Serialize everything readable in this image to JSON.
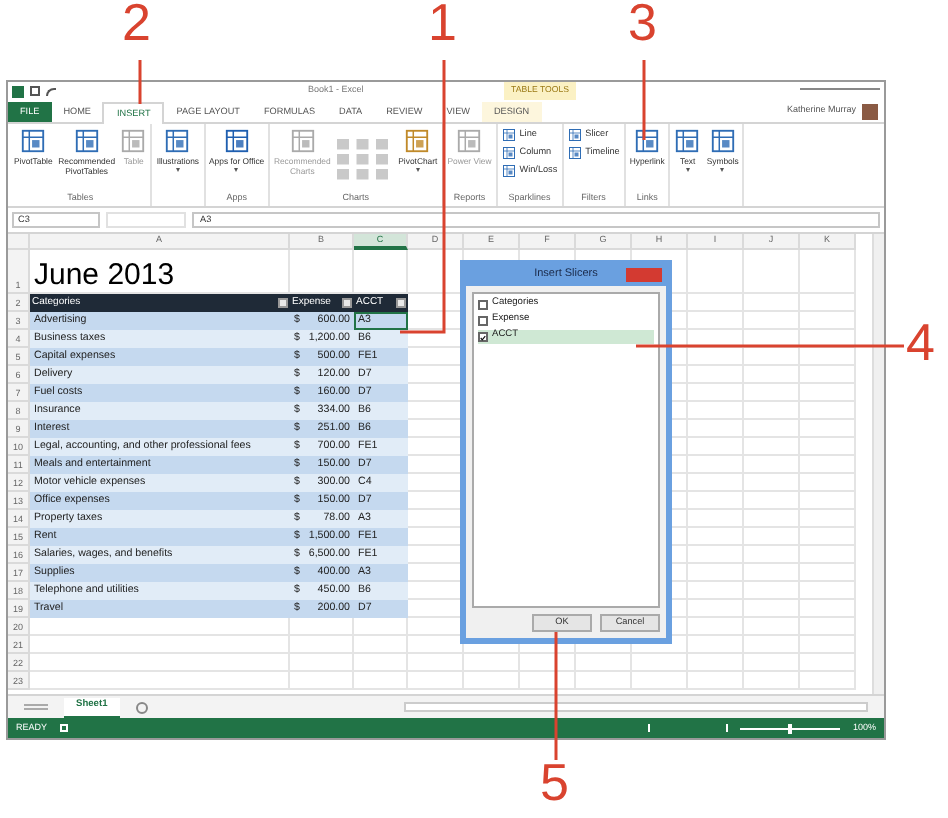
{
  "callouts": [
    {
      "label": "2"
    },
    {
      "label": "1"
    },
    {
      "label": "3"
    },
    {
      "label": "4"
    },
    {
      "label": "5"
    }
  ],
  "window": {
    "title": "Book1 - Excel",
    "contextual_group": "TABLE TOOLS",
    "user": "Katherine Murray"
  },
  "ribbon_tabs": [
    {
      "label": "FILE",
      "kind": "file",
      "selected": false
    },
    {
      "label": "HOME",
      "kind": "tab",
      "selected": false
    },
    {
      "label": "INSERT",
      "kind": "tab",
      "selected": true
    },
    {
      "label": "PAGE LAYOUT",
      "kind": "tab",
      "selected": false
    },
    {
      "label": "FORMULAS",
      "kind": "tab",
      "selected": false
    },
    {
      "label": "DATA",
      "kind": "tab",
      "selected": false
    },
    {
      "label": "REVIEW",
      "kind": "tab",
      "selected": false
    },
    {
      "label": "VIEW",
      "kind": "tab",
      "selected": false
    },
    {
      "label": "DESIGN",
      "kind": "contextual",
      "selected": false
    }
  ],
  "ribbon_groups": [
    {
      "label": "Tables",
      "commands": [
        {
          "label": "PivotTable",
          "kind": "large",
          "disabled": false,
          "dropdown": false
        },
        {
          "label": "Recommended PivotTables",
          "kind": "large",
          "disabled": false,
          "dropdown": false
        },
        {
          "label": "Table",
          "kind": "large",
          "disabled": true,
          "dropdown": false
        }
      ]
    },
    {
      "commands": [
        {
          "label": "Illustrations",
          "kind": "large",
          "disabled": false,
          "dropdown": true
        }
      ]
    },
    {
      "label": "Apps",
      "commands": [
        {
          "label": "Apps for Office",
          "kind": "large",
          "disabled": false,
          "dropdown": true
        }
      ]
    },
    {
      "label": "Charts",
      "commands": [
        {
          "label": "Recommended Charts",
          "kind": "large",
          "disabled": true,
          "dropdown": false
        },
        {
          "kind": "chart-grid",
          "disabled": true
        },
        {
          "label": "PivotChart",
          "kind": "large",
          "disabled": false,
          "dropdown": true
        }
      ]
    },
    {
      "label": "Reports",
      "commands": [
        {
          "label": "Power View",
          "kind": "large",
          "disabled": true,
          "dropdown": false
        }
      ]
    },
    {
      "label": "Sparklines",
      "commands": [
        {
          "label": "Line",
          "kind": "small",
          "disabled": false
        },
        {
          "label": "Column",
          "kind": "small",
          "disabled": false
        },
        {
          "label": "Win/Loss",
          "kind": "small",
          "disabled": false
        }
      ]
    },
    {
      "label": "Filters",
      "commands": [
        {
          "label": "Slicer",
          "kind": "small",
          "disabled": false
        },
        {
          "label": "Timeline",
          "kind": "small",
          "disabled": false
        }
      ]
    },
    {
      "label": "Links",
      "commands": [
        {
          "label": "Hyperlink",
          "kind": "large",
          "disabled": false,
          "dropdown": false
        }
      ]
    },
    {
      "commands": [
        {
          "label": "Text",
          "kind": "large",
          "disabled": false,
          "dropdown": true
        },
        {
          "label": "Symbols",
          "kind": "large",
          "disabled": false,
          "dropdown": true
        }
      ]
    }
  ],
  "formula_bar": {
    "name_box": "C3",
    "formula": "A3"
  },
  "columns": [
    {
      "label": "A",
      "selected": false
    },
    {
      "label": "B",
      "selected": false
    },
    {
      "label": "C",
      "selected": true
    },
    {
      "label": "D",
      "selected": false
    },
    {
      "label": "E",
      "selected": false
    },
    {
      "label": "F",
      "selected": false
    },
    {
      "label": "G",
      "selected": false
    },
    {
      "label": "H",
      "selected": false
    },
    {
      "label": "I",
      "selected": false
    },
    {
      "label": "J",
      "selected": false
    },
    {
      "label": "K",
      "selected": false
    }
  ],
  "sheet": {
    "title_row": "1",
    "title": "June 2013",
    "header_row": "2",
    "headers": [
      "Categories",
      "Expense",
      "ACCT"
    ],
    "rows": [
      {
        "row": "3",
        "category": "Advertising",
        "currency": "$",
        "amount": "600.00",
        "acct": "A3",
        "selected": true
      },
      {
        "row": "4",
        "category": "Business taxes",
        "currency": "$",
        "amount": "1,200.00",
        "acct": "B6",
        "selected": false
      },
      {
        "row": "5",
        "category": "Capital expenses",
        "currency": "$",
        "amount": "500.00",
        "acct": "FE1",
        "selected": false
      },
      {
        "row": "6",
        "category": "Delivery",
        "currency": "$",
        "amount": "120.00",
        "acct": "D7",
        "selected": false
      },
      {
        "row": "7",
        "category": "Fuel costs",
        "currency": "$",
        "amount": "160.00",
        "acct": "D7",
        "selected": false
      },
      {
        "row": "8",
        "category": "Insurance",
        "currency": "$",
        "amount": "334.00",
        "acct": "B6",
        "selected": false
      },
      {
        "row": "9",
        "category": "Interest",
        "currency": "$",
        "amount": "251.00",
        "acct": "B6",
        "selected": false
      },
      {
        "row": "10",
        "category": "Legal, accounting, and other professional fees",
        "currency": "$",
        "amount": "700.00",
        "acct": "FE1",
        "selected": false
      },
      {
        "row": "11",
        "category": "Meals and entertainment",
        "currency": "$",
        "amount": "150.00",
        "acct": "D7",
        "selected": false
      },
      {
        "row": "12",
        "category": "Motor vehicle expenses",
        "currency": "$",
        "amount": "300.00",
        "acct": "C4",
        "selected": false
      },
      {
        "row": "13",
        "category": "Office expenses",
        "currency": "$",
        "amount": "150.00",
        "acct": "D7",
        "selected": false
      },
      {
        "row": "14",
        "category": "Property taxes",
        "currency": "$",
        "amount": "78.00",
        "acct": "A3",
        "selected": false
      },
      {
        "row": "15",
        "category": "Rent",
        "currency": "$",
        "amount": "1,500.00",
        "acct": "FE1",
        "selected": false
      },
      {
        "row": "16",
        "category": "Salaries, wages, and benefits",
        "currency": "$",
        "amount": "6,500.00",
        "acct": "FE1",
        "selected": false
      },
      {
        "row": "17",
        "category": "Supplies",
        "currency": "$",
        "amount": "400.00",
        "acct": "A3",
        "selected": false
      },
      {
        "row": "18",
        "category": "Telephone and utilities",
        "currency": "$",
        "amount": "450.00",
        "acct": "B6",
        "selected": false
      },
      {
        "row": "19",
        "category": "Travel",
        "currency": "$",
        "amount": "200.00",
        "acct": "D7",
        "selected": false
      }
    ],
    "empty_rows": [
      "20",
      "21",
      "22",
      "23"
    ]
  },
  "dialog": {
    "title": "Insert Slicers",
    "options": [
      {
        "label": "Categories",
        "checked": false,
        "selected": false
      },
      {
        "label": "Expense",
        "checked": false,
        "selected": false
      },
      {
        "label": "ACCT",
        "checked": true,
        "selected": true
      }
    ],
    "buttons": [
      "OK",
      "Cancel"
    ]
  },
  "sheet_tabs": [
    {
      "label": "Sheet1",
      "selected": true
    }
  ],
  "status_bar": {
    "status": "READY",
    "zoom_slider": {
      "level": 0.5
    },
    "zoom": "100%"
  }
}
